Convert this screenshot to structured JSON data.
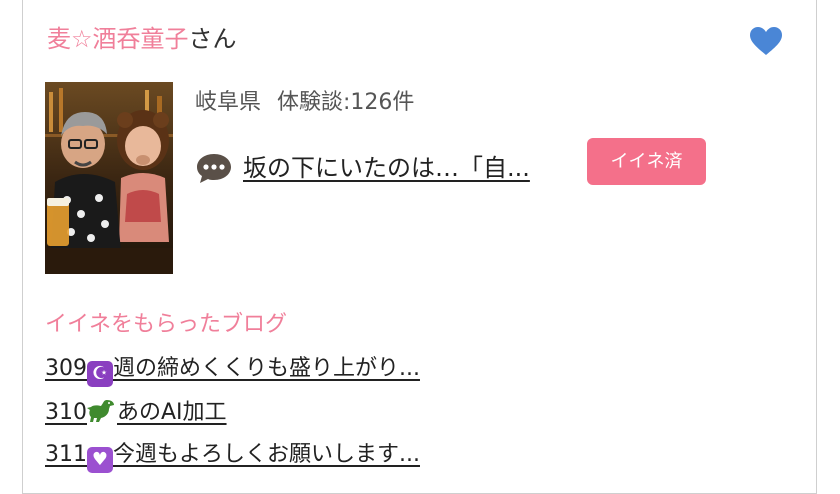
{
  "user": {
    "name": "麦☆酒呑童子",
    "suffix": "さん",
    "prefecture": "岐阜県",
    "review_count": "体験談:126件",
    "latest_review_title": "坂の下にいたのは…「自...",
    "like_badge": "イイネ済"
  },
  "icons": {
    "favorite": "heart-icon",
    "review": "speech-bubble-icon"
  },
  "colors": {
    "accent_pink": "#f07f9a",
    "badge_pink": "#f4708a",
    "heart_blue": "#4a86d6"
  },
  "blogs": {
    "title": "イイネをもらったブログ",
    "items": [
      {
        "number": "309",
        "emoji": "moon-star-icon",
        "text": "週の締めくくりも盛り上がり..."
      },
      {
        "number": "310",
        "emoji": "dinosaur-icon",
        "text": "あのAI加工"
      },
      {
        "number": "311",
        "emoji": "heart-box-icon",
        "text": "今週もよろしくお願いします..."
      }
    ]
  }
}
